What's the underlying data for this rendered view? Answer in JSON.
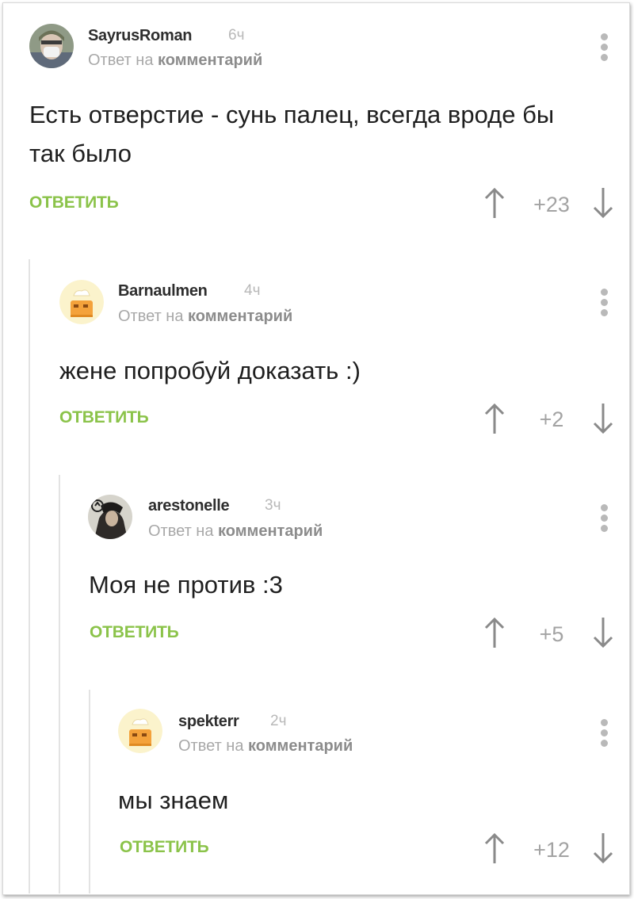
{
  "comments": [
    {
      "username": "SayrusRoman",
      "time": "6ч",
      "reply_prefix": "Ответ на",
      "reply_target": "комментарий",
      "text_line1": "Есть отверстие - сунь палец, всегда вроде бы",
      "text_line2": "так было",
      "reply_label": "ОТВЕТИТЬ",
      "score": "+23"
    },
    {
      "username": "Barnaulmen",
      "time": "4ч",
      "reply_prefix": "Ответ на",
      "reply_target": "комментарий",
      "text_line1": "жене попробуй доказать :)",
      "reply_label": "ОТВЕТИТЬ",
      "score": "+2"
    },
    {
      "username": "arestonelle",
      "time": "3ч",
      "reply_prefix": "Ответ на",
      "reply_target": "комментарий",
      "text_line1": "Моя не против :3",
      "reply_label": "ОТВЕТИТЬ",
      "score": "+5"
    },
    {
      "username": "spekterr",
      "time": "2ч",
      "reply_prefix": "Ответ на",
      "reply_target": "комментарий",
      "text_line1": "мы знаем",
      "reply_label": "ОТВЕТИТЬ",
      "score": "+12"
    }
  ],
  "colors": {
    "reply_green": "#8bc34a",
    "muted_gray": "#a8a8a8",
    "thread_line": "#e3e3e3"
  },
  "icons": [
    "avatar",
    "more-vertical-icon",
    "upvote-arrow-icon",
    "downvote-arrow-icon"
  ]
}
